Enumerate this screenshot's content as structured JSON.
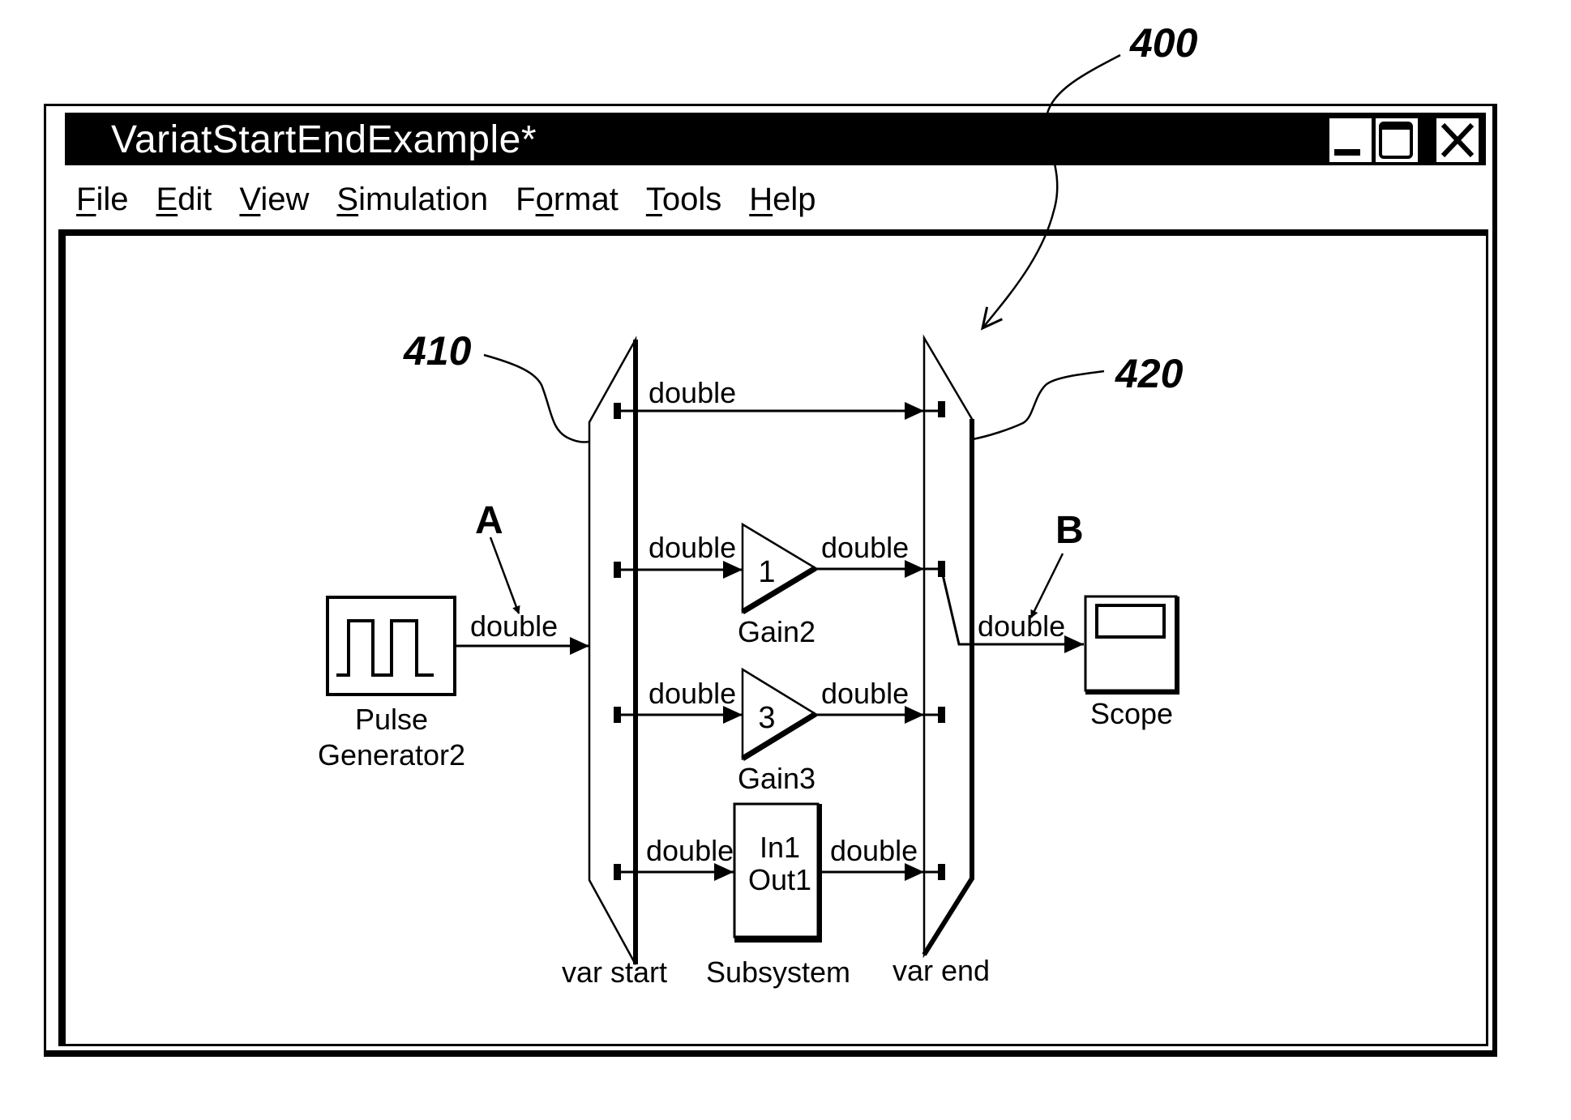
{
  "window": {
    "title": "VariatStartEndExample*",
    "controls": {
      "minimize": "minimize",
      "maximize": "maximize",
      "close": "close"
    }
  },
  "menubar": [
    {
      "label": "File",
      "mnemonic_index": 0
    },
    {
      "label": "Edit",
      "mnemonic_index": 0
    },
    {
      "label": "View",
      "mnemonic_index": 0
    },
    {
      "label": "Simulation",
      "mnemonic_index": 0
    },
    {
      "label": "Format",
      "mnemonic_index": 1
    },
    {
      "label": "Tools",
      "mnemonic_index": 0
    },
    {
      "label": "Help",
      "mnemonic_index": 0
    }
  ],
  "diagram": {
    "reference_labels": {
      "figure": "400",
      "var_start": "410",
      "var_end": "420",
      "point_a": "A",
      "point_b": "B"
    },
    "blocks": {
      "pulse_generator": {
        "name_line1": "Pulse",
        "name_line2": "Generator2"
      },
      "var_start": {
        "name": "var start"
      },
      "var_end": {
        "name": "var end"
      },
      "gain2": {
        "name": "Gain2",
        "value": "1"
      },
      "gain3": {
        "name": "Gain3",
        "value": "3"
      },
      "subsystem": {
        "name": "Subsystem",
        "port_in": "In1",
        "port_out": "Out1"
      },
      "scope": {
        "name": "Scope"
      }
    },
    "signals": {
      "pulse_to_start": "double",
      "row1": "double",
      "row2_in": "double",
      "row2_out": "double",
      "row3_in": "double",
      "row3_out": "double",
      "row4_in": "double",
      "row4_out": "double",
      "end_to_scope": "double"
    }
  }
}
